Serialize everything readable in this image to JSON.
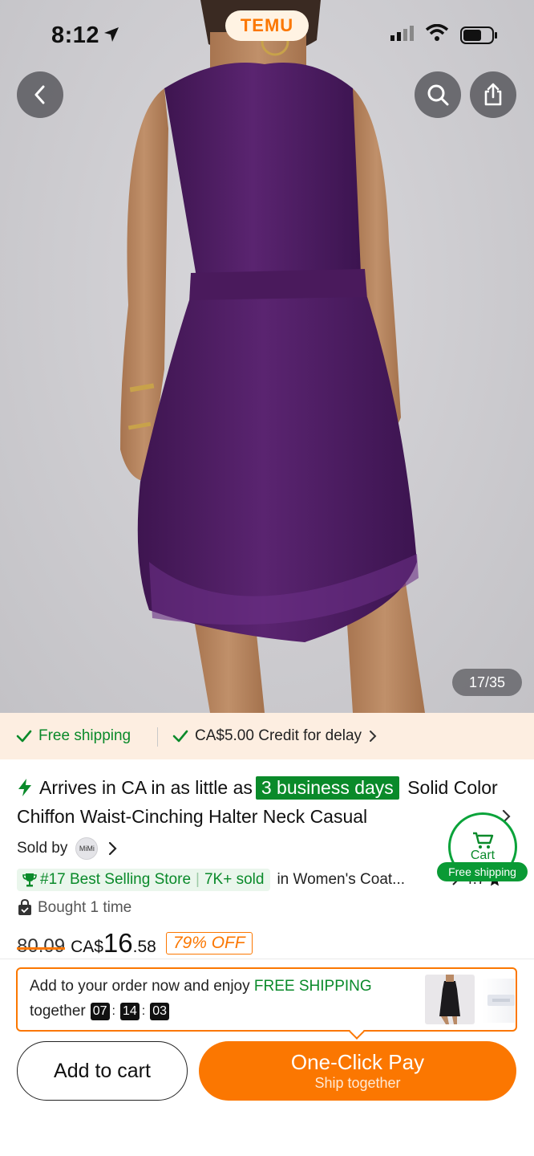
{
  "status_bar": {
    "time": "8:12",
    "brand": "TEMU"
  },
  "gallery": {
    "counter": "17/35"
  },
  "shipping_strip": {
    "free_shipping": "Free shipping",
    "credit": "CA$5.00 Credit for delay"
  },
  "product": {
    "arrives_prefix": "Arrives in CA in as little as",
    "arrives_days": "3 business days",
    "title": "Solid Color Chiffon Waist-Cinching Halter Neck Casual",
    "sold_by_label": "Sold by",
    "store_avatar": "MiMi",
    "best_selling": "#17 Best Selling Store",
    "sold_count": "7K+ sold",
    "category": "in Women's Coat...",
    "rating": "4.7",
    "bought": "Bought 1 time",
    "old_price": "80.09",
    "currency": "CA$",
    "price_int": "16",
    "price_dec": ".58",
    "discount": "79% OFF"
  },
  "cart_widget": {
    "label": "Cart",
    "tag": "Free shipping"
  },
  "promo": {
    "line1_prefix": "Add to your order now and enjoy",
    "line1_highlight": "FREE SHIPPING",
    "line2_prefix": "together",
    "timer": {
      "h": "07",
      "m": "14",
      "s": "03"
    }
  },
  "actions": {
    "add_to_cart": "Add to cart",
    "one_click": "One-Click Pay",
    "one_click_sub": "Ship together"
  },
  "colors": {
    "accent": "#fb7701",
    "green": "#0a8a2a",
    "dress": "#4e1e5e"
  },
  "icons": [
    "location-arrow-icon",
    "signal-icon",
    "wifi-icon",
    "battery-icon",
    "back-icon",
    "search-icon",
    "share-icon",
    "check-icon",
    "chevron-right-icon",
    "bolt-icon",
    "cart-icon",
    "trophy-icon",
    "bag-icon",
    "star-icon"
  ]
}
